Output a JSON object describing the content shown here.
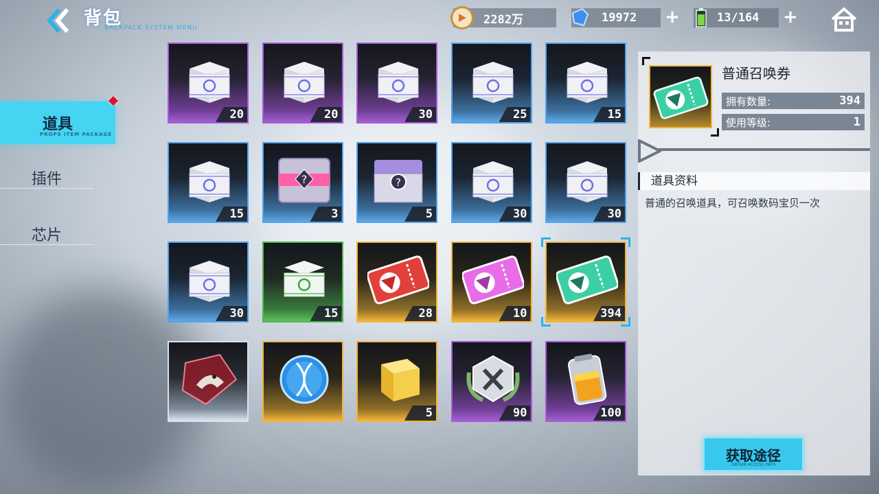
{
  "header": {
    "title": "背包",
    "title_sub": "BACKPACK SYSTEM MENU",
    "gold": "2282万",
    "gems": "19972",
    "energy": "13/164"
  },
  "tabs": [
    {
      "label": "道具",
      "active": true,
      "sub": "PROPS ITEM PACKAGE"
    },
    {
      "label": "插件",
      "active": false
    },
    {
      "label": "芯片",
      "active": false
    }
  ],
  "items": [
    {
      "qty": "20",
      "rarity": "purple",
      "icon": "white-box-icon"
    },
    {
      "qty": "20",
      "rarity": "purple",
      "icon": "white-box-icon"
    },
    {
      "qty": "30",
      "rarity": "purple",
      "icon": "white-box-icon"
    },
    {
      "qty": "25",
      "rarity": "blue",
      "icon": "white-box-icon"
    },
    {
      "qty": "15",
      "rarity": "blue",
      "icon": "white-box-icon"
    },
    {
      "qty": "15",
      "rarity": "blue",
      "icon": "white-box-icon"
    },
    {
      "qty": "3",
      "rarity": "blue",
      "icon": "mystery-chest-pink-icon"
    },
    {
      "qty": "5",
      "rarity": "blue",
      "icon": "mystery-chest-purple-icon"
    },
    {
      "qty": "30",
      "rarity": "blue",
      "icon": "white-box-icon"
    },
    {
      "qty": "30",
      "rarity": "blue",
      "icon": "white-box-icon"
    },
    {
      "qty": "30",
      "rarity": "blue",
      "icon": "white-box-icon"
    },
    {
      "qty": "15",
      "rarity": "green",
      "icon": "green-box-icon"
    },
    {
      "qty": "28",
      "rarity": "gold",
      "icon": "red-ticket-icon"
    },
    {
      "qty": "10",
      "rarity": "gold",
      "icon": "pink-ticket-icon"
    },
    {
      "qty": "394",
      "rarity": "gold",
      "icon": "green-ticket-icon",
      "selected": true
    },
    {
      "qty": "",
      "rarity": "white",
      "icon": "digimon-cube-icon"
    },
    {
      "qty": "",
      "rarity": "gold",
      "icon": "dna-orb-icon"
    },
    {
      "qty": "5",
      "rarity": "gold",
      "icon": "gold-cube-icon"
    },
    {
      "qty": "90",
      "rarity": "purple",
      "icon": "x-badge-icon"
    },
    {
      "qty": "100",
      "rarity": "purple",
      "icon": "energy-battery-icon"
    }
  ],
  "detail": {
    "name": "普通召唤券",
    "owned_label": "拥有数量:",
    "owned_value": "394",
    "level_label": "使用等级:",
    "level_value": "1",
    "section_title": "道具资料",
    "description": "普通的召唤道具，可召唤数码宝贝一次",
    "obtain_label": "获取途径",
    "obtain_sub": "OBTAIN ACCESS PATH"
  },
  "colors": {
    "accent": "#45d4f2",
    "purple": "#a65ad6",
    "blue": "#54a3e8",
    "green": "#4fb64d",
    "gold": "#f2b43a"
  }
}
